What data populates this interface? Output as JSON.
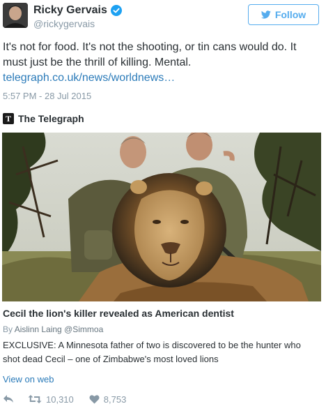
{
  "author": {
    "display_name": "Ricky Gervais",
    "handle": "@rickygervais"
  },
  "follow_button": {
    "label": "Follow"
  },
  "tweet": {
    "text": "It's not for food. It's not the shooting, or tin cans would do. It must just be the thrill of killing. Mental. ",
    "link_text": "telegraph.co.uk/news/worldnews…",
    "timestamp": "5:57 PM - 28 Jul 2015"
  },
  "card": {
    "source_name": "The Telegraph",
    "source_logo_letter": "T",
    "title": "Cecil the lion's killer revealed as American dentist",
    "byline_prefix": "By ",
    "byline_name": "Aislinn Laing",
    "byline_handle": "@Simmoa",
    "description": "EXCLUSIVE: A Minnesota father of two is discovered to be the hunter who shot dead Cecil – one of Zimbabwe's most loved lions"
  },
  "view_on_web": "View on web",
  "stats": {
    "retweets": "10,310",
    "likes": "8,753"
  },
  "colors": {
    "link": "#2b7bb9",
    "follow_blue": "#55acee",
    "muted": "#8899a6",
    "verified": "#1da1f2"
  },
  "icons": [
    "verified-badge-icon",
    "twitter-bird-icon",
    "telegraph-logo-icon",
    "reply-icon",
    "retweet-icon",
    "heart-icon"
  ]
}
